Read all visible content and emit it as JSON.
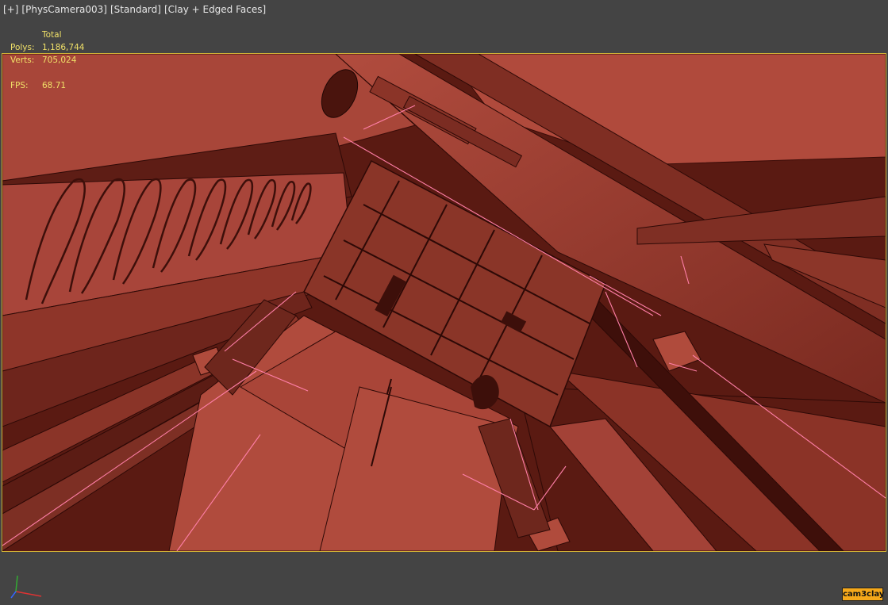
{
  "viewport_label": {
    "plus": "[+]",
    "camera": "[PhysCamera003]",
    "preset": "[Standard]",
    "style": "[Clay + Edged Faces]"
  },
  "stats": {
    "header": "Total",
    "polys_label": "Polys:",
    "polys_value": "1,186,744",
    "verts_label": "Verts:",
    "verts_value": "705,024",
    "fps_label": "FPS:",
    "fps_value": "68.71"
  },
  "footer": {
    "cam_tag": "cam3clay"
  },
  "colors": {
    "background": "#444444",
    "viewport_border": "#d1b236",
    "stats_text": "#f0e068",
    "clay": "#a8463a",
    "selection_lines": "#ff7fa8",
    "cam_tag_bg": "#f5a81a"
  },
  "icons": [
    "axis-gizmo-icon"
  ]
}
